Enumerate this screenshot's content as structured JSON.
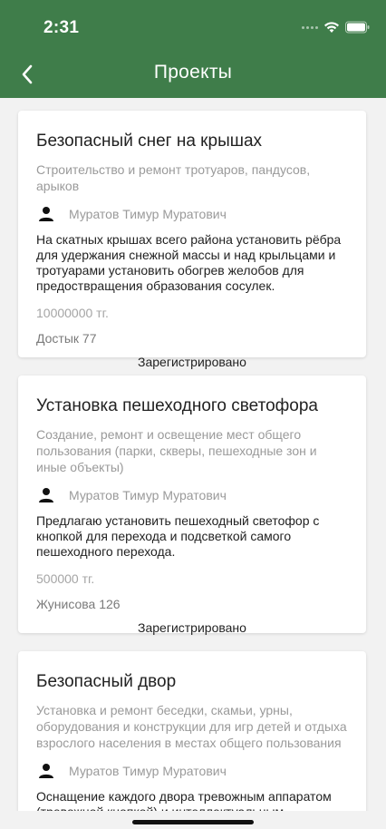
{
  "status_bar": {
    "time": "2:31"
  },
  "nav": {
    "title": "Проекты",
    "back_icon": "chevron-left-icon"
  },
  "colors": {
    "header": "#3f7d4a",
    "background": "#f2f2f2",
    "card": "#ffffff"
  },
  "projects": [
    {
      "title": "Безопасный снег на крышах",
      "category": "Строительство и ремонт тротуаров, пандусов, арыков",
      "author": "Муратов Тимур Муратович",
      "description": "На скатных крышах всего района установить рёбра для удержания снежной массы и над крыльцами и тротуарами установить обогрев желобов для предоствращения образования сосулек.",
      "budget": "10000000 тг.",
      "address": "Достык 77",
      "status": "Зарегистрировано"
    },
    {
      "title": "Установка пешеходного светофора",
      "category": "Создание, ремонт и освещение мест общего пользования (парки, скверы, пешеходные зон и иные объекты)",
      "author": "Муратов Тимур Муратович",
      "description": "Предлагаю установить пешеходный светофор с кнопкой для перехода и подсветкой самого пешеходного перехода.",
      "budget": "500000 тг.",
      "address": "Жунисова 126",
      "status": "Зарегистрировано"
    },
    {
      "title": "Безопасный двор",
      "category": "Установка и ремонт беседки, скамьи, урны, оборудования и конструкции для игр детей и отдыха взрослого населения в местах общего пользования",
      "author": "Муратов Тимур Муратович",
      "description": "Оснащение каждого двора тревожным аппаратом (тревожной кнопкой) и интеллектуальным"
    }
  ]
}
